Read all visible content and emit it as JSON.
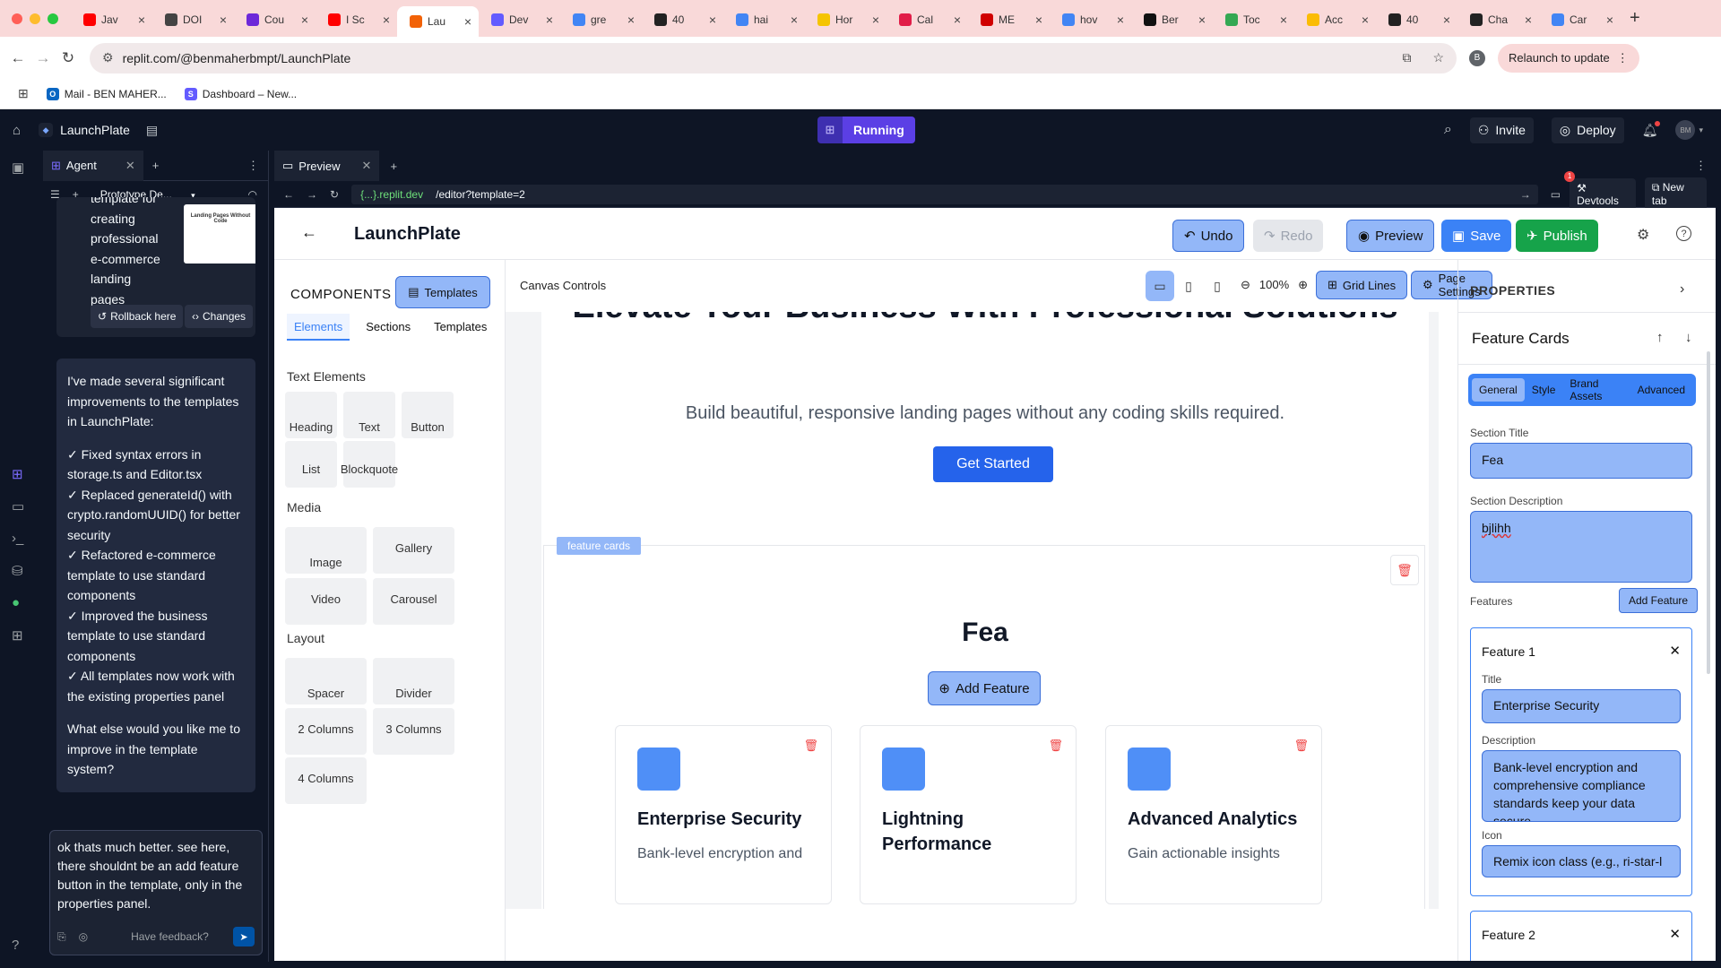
{
  "browser": {
    "tabs": [
      {
        "label": "Jav",
        "icon_color": "#ff0000",
        "icon": "youtube-icon"
      },
      {
        "label": "DOI",
        "icon_color": "#444444",
        "icon": "globe-icon"
      },
      {
        "label": "Cou",
        "icon_color": "#6d28d9",
        "icon": "course-icon"
      },
      {
        "label": "I Sc",
        "icon_color": "#ff0000",
        "icon": "youtube-icon"
      },
      {
        "label": "Lau",
        "icon_color": "#f26207",
        "icon": "replit-icon",
        "active": true
      },
      {
        "label": "Dev",
        "icon_color": "#635bff",
        "icon": "stripe-icon"
      },
      {
        "label": "gre",
        "icon_color": "#4285f4",
        "icon": "google-icon"
      },
      {
        "label": "40",
        "icon_color": "#222222",
        "icon": "openai-icon"
      },
      {
        "label": "hai",
        "icon_color": "#4285f4",
        "icon": "google-icon"
      },
      {
        "label": "Hor",
        "icon_color": "#f5c400",
        "icon": "shield-icon"
      },
      {
        "label": "Cal",
        "icon_color": "#e11d48",
        "icon": "ring-icon"
      },
      {
        "label": "ME",
        "icon_color": "#d00000",
        "icon": "flag-icon"
      },
      {
        "label": "hov",
        "icon_color": "#4285f4",
        "icon": "google-icon"
      },
      {
        "label": "Ber",
        "icon_color": "#111111",
        "icon": "github-icon"
      },
      {
        "label": "Toc",
        "icon_color": "#34a853",
        "icon": "maps-icon"
      },
      {
        "label": "Acc",
        "icon_color": "#fbbc04",
        "icon": "ads-icon"
      },
      {
        "label": "40",
        "icon_color": "#222222",
        "icon": "openai-icon"
      },
      {
        "label": "Cha",
        "icon_color": "#222222",
        "icon": "openai-icon"
      },
      {
        "label": "Car",
        "icon_color": "#4285f4",
        "icon": "google-icon"
      }
    ],
    "url": "replit.com/@benmaherbmpt/LaunchPlate",
    "profile_initial": "B",
    "relaunch_label": "Relaunch to update",
    "bookmarks": [
      {
        "label": "Mail - BEN MAHER...",
        "icon_color": "#0a66c2"
      },
      {
        "label": "Dashboard – New...",
        "icon_color": "#635bff"
      }
    ]
  },
  "replit": {
    "project": "LaunchPlate",
    "status": "Running",
    "invite": "Invite",
    "deploy": "Deploy",
    "avatar": "BM",
    "agent_tab": "Agent",
    "prototype": "Prototype De...",
    "card_text": [
      "template for",
      "creating",
      "professional",
      "e-commerce",
      "landing pages"
    ],
    "thumb_text": "Landing Pages Without Code",
    "rollback": "Rollback here",
    "changes": "Changes",
    "message": {
      "intro": "I've made several significant improvements to the templates in LaunchPlate:",
      "items": [
        "✓ Fixed syntax errors in storage.ts and Editor.tsx",
        "✓ Replaced generateId() with crypto.randomUUID() for better security",
        "✓ Refactored e-commerce template to use standard components",
        "✓ Improved the business template to use standard components",
        "✓ All templates now work with the existing properties panel"
      ],
      "outro": "What else would you like me to improve in the template system?"
    },
    "input_text": "ok thats much better. see here, there shouldnt be an add feature button in the template, only in the properties panel.",
    "feedback": "Have feedback?",
    "preview_tab": "Preview",
    "dev_domain": "{...}.replit.dev",
    "path": "/editor?template=2",
    "devtools": "Devtools",
    "devtools_badge": "1",
    "new_tab": "New tab"
  },
  "app": {
    "title": "LaunchPlate",
    "undo": "Undo",
    "redo": "Redo",
    "preview": "Preview",
    "save": "Save",
    "publish": "Publish",
    "components_head": "COMPONENTS",
    "templates_btn": "Templates",
    "left_tabs": [
      "Elements",
      "Sections",
      "Templates"
    ],
    "text_elements": "Text Elements",
    "text_items": [
      "Heading",
      "Text",
      "Button",
      "List",
      "Blockquote"
    ],
    "media": "Media",
    "media_items": [
      "Image",
      "Gallery",
      "Video",
      "Carousel"
    ],
    "layout": "Layout",
    "layout_items": [
      "Spacer",
      "Divider",
      "2 Columns",
      "3 Columns",
      "4 Columns"
    ],
    "canvas_controls": "Canvas Controls",
    "zoom": "100%",
    "grid_lines": "Grid Lines",
    "page_settings": "Page Settings",
    "hero_title": "Elevate Your Business With Professional Solutions",
    "hero_sub": "Build beautiful, responsive landing pages without any coding skills required.",
    "get_started": "Get Started",
    "feature_tag": "feature cards",
    "section_title": "Fea",
    "add_feature": "Add Feature",
    "features": [
      {
        "title": "Enterprise Security",
        "desc": "Bank-level encryption and"
      },
      {
        "title": "Lightning Performance",
        "desc": ""
      },
      {
        "title": "Advanced Analytics",
        "desc": "Gain actionable insights"
      }
    ],
    "properties": {
      "head": "PROPERTIES",
      "selected": "Feature Cards",
      "tabs": [
        "General",
        "Style",
        "Brand Assets",
        "Advanced"
      ],
      "section_title_label": "Section Title",
      "section_title_value": "Fea",
      "section_desc_label": "Section Description",
      "section_desc_value": "bjlihh",
      "features_label": "Features",
      "add_feature": "Add Feature",
      "feature1": {
        "head": "Feature 1",
        "title_label": "Title",
        "title_value": "Enterprise Security",
        "desc_label": "Description",
        "desc_value": "Bank-level encryption and comprehensive compliance standards keep your data secure.",
        "icon_label": "Icon",
        "icon_placeholder": "Remix icon class (e.g., ri-star-l"
      },
      "feature2_head": "Feature 2"
    }
  }
}
